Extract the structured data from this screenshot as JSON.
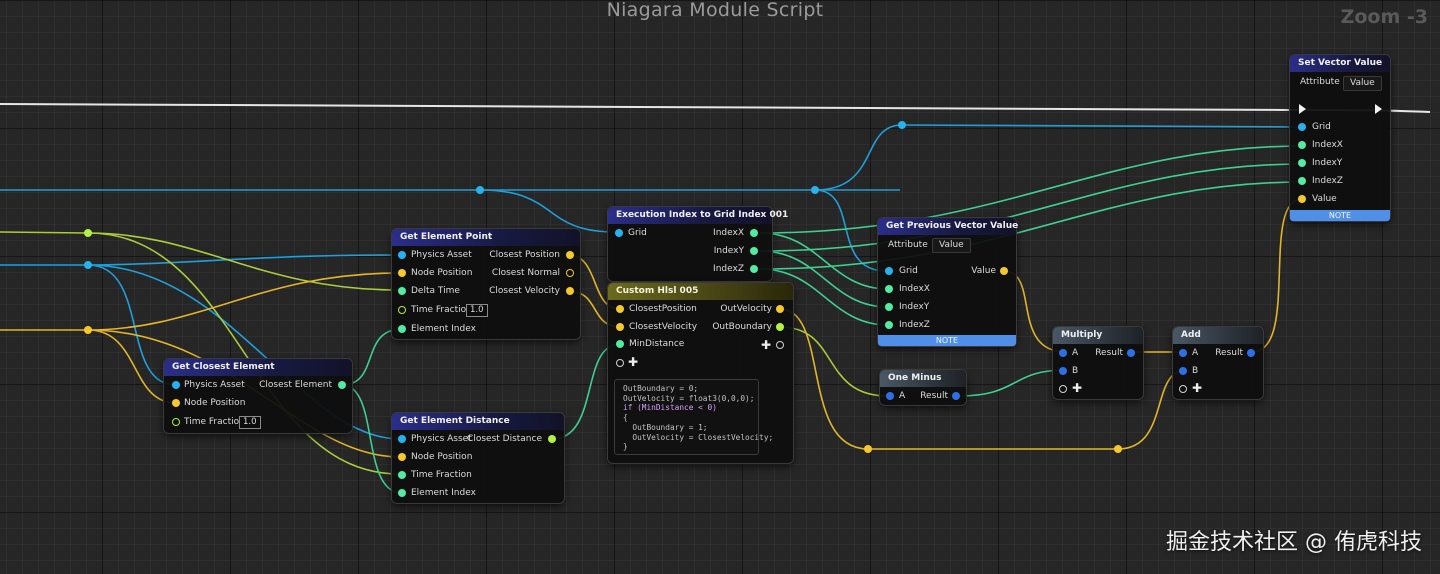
{
  "graph": {
    "title": "Niagara Module Script",
    "zoom": "Zoom -3"
  },
  "colors": {
    "float": "#53eaa2",
    "vector": "#f5c82b",
    "grid": "#24b3ee",
    "bool": "#b5f043",
    "int": "#2f6fe6",
    "note": "#4f8fe8"
  },
  "nodes": {
    "get_closest_element": {
      "title": "Get Closest Element",
      "pins": {
        "physics_asset": "Physics Asset",
        "node_position": "Node Position",
        "time_fraction": "Time Fraction",
        "closest_element": "Closest Element"
      },
      "time_fraction_value": "1.0"
    },
    "get_element_point": {
      "title": "Get Element Point",
      "pins": {
        "physics_asset": "Physics Asset",
        "node_position": "Node Position",
        "delta_time": "Delta Time",
        "time_fraction": "Time Fraction",
        "element_index": "Element Index",
        "closest_position": "Closest Position",
        "closest_normal": "Closest Normal",
        "closest_velocity": "Closest Velocity"
      },
      "time_fraction_value": "1.0"
    },
    "get_element_distance": {
      "title": "Get Element Distance",
      "pins": {
        "physics_asset": "Physics Asset",
        "node_position": "Node Position",
        "time_fraction": "Time Fraction",
        "element_index": "Element Index",
        "closest_distance": "Closest Distance"
      }
    },
    "execution_index": {
      "title": "Execution Index to Grid Index 001",
      "pins": {
        "grid": "Grid",
        "index_x": "IndexX",
        "index_y": "IndexY",
        "index_z": "IndexZ"
      }
    },
    "custom_hlsl": {
      "title": "Custom Hlsl 005",
      "pins": {
        "closest_position": "ClosestPosition",
        "closest_velocity": "ClosestVelocity",
        "min_distance": "MinDistance",
        "out_velocity": "OutVelocity",
        "out_boundary": "OutBoundary"
      },
      "code": [
        "OutBoundary = 0;",
        "OutVelocity = float3(0,0,0);",
        "if (MinDistance < 0)",
        "{",
        "  OutBoundary = 1;",
        "  OutVelocity = ClosestVelocity;",
        "}"
      ]
    },
    "get_previous_vector": {
      "title": "Get Previous Vector Value",
      "attribute_label": "Attribute",
      "attribute_value": "Value",
      "pins": {
        "grid": "Grid",
        "index_x": "IndexX",
        "index_y": "IndexY",
        "index_z": "IndexZ",
        "value": "Value"
      },
      "note": "NOTE"
    },
    "set_vector": {
      "title": "Set Vector Value",
      "attribute_label": "Attribute",
      "attribute_value": "Value",
      "pins": {
        "grid": "Grid",
        "index_x": "IndexX",
        "index_y": "IndexY",
        "index_z": "IndexZ",
        "value": "Value"
      },
      "note": "NOTE"
    },
    "one_minus": {
      "title": "One Minus",
      "pins": {
        "a": "A",
        "result": "Result"
      }
    },
    "multiply": {
      "title": "Multiply",
      "pins": {
        "a": "A",
        "b": "B",
        "result": "Result"
      }
    },
    "add": {
      "title": "Add",
      "pins": {
        "a": "A",
        "b": "B",
        "result": "Result"
      }
    }
  },
  "watermark": "掘金技术社区 @ 侑虎科技"
}
